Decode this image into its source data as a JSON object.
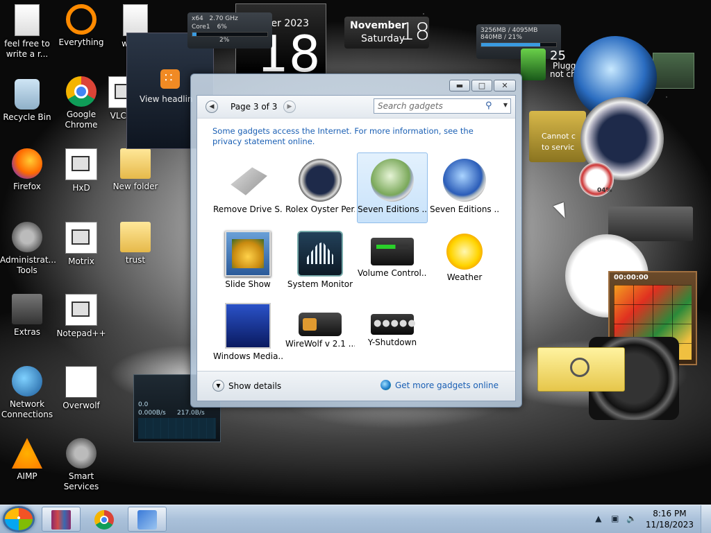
{
  "desktop_icons": [
    {
      "label": "feel free to write a r...",
      "icon": "text-document-icon"
    },
    {
      "label": "Everything",
      "icon": "everything-search-icon"
    },
    {
      "label": "www...",
      "icon": "text-document-icon"
    },
    {
      "label": "Recycle Bin",
      "icon": "recycle-bin-icon"
    },
    {
      "label": "Google Chrome",
      "icon": "chrome-icon"
    },
    {
      "label": "VLC...",
      "icon": "vlc-icon"
    },
    {
      "label": "Firefox",
      "icon": "firefox-icon"
    },
    {
      "label": "HxD",
      "icon": "hxd-icon"
    },
    {
      "label": "New folder",
      "icon": "folder-icon"
    },
    {
      "label": "Administrat... Tools",
      "icon": "admin-tools-icon"
    },
    {
      "label": "Motrix",
      "icon": "motrix-icon"
    },
    {
      "label": "trust",
      "icon": "folder-icon"
    },
    {
      "label": "Extras",
      "icon": "folder-icon"
    },
    {
      "label": "Notepad++",
      "icon": "notepad-plus-icon"
    },
    {
      "label": "Network Connections",
      "icon": "network-icon"
    },
    {
      "label": "Overwolf",
      "icon": "overwolf-icon"
    },
    {
      "label": "AIMP",
      "icon": "aimp-icon"
    },
    {
      "label": "Smart Services",
      "icon": "services-icon"
    }
  ],
  "gadgets": {
    "cpu": {
      "arch": "x64",
      "freq": "2.70 GHz",
      "core1_label": "Core1",
      "core1_value": "6%",
      "core2_value": "2%",
      "core1_fraction": 0.06,
      "core2_fraction": 0.02
    },
    "calendar": {
      "month_year": "mber 2023",
      "day": "18"
    },
    "date": {
      "month": "November",
      "weekday": "Saturday",
      "day": "18"
    },
    "memory": {
      "used": "3256MB / 4095MB",
      "free": "840MB / 21%",
      "fraction": 0.79
    },
    "rss": {
      "label": "View headlin"
    },
    "plugged": {
      "line1": "Plugg",
      "line2": "not ch",
      "num": "25"
    },
    "cannot_connect": {
      "line1": "Cannot c",
      "line2": "to servic"
    },
    "cpu_percent": "04%",
    "network": {
      "down": "0.000B/s",
      "up": "217.0B/s",
      "ip_prefix": "0.0"
    },
    "puzzle_timer": "00:00:00"
  },
  "gallery": {
    "page_label": "Page 3 of 3",
    "search_placeholder": "Search gadgets",
    "privacy_text": "Some gadgets access the Internet.  For more information, see the privacy statement online.",
    "tiles": [
      {
        "label": "Remove Drive S...",
        "icon": "usb-drive-icon"
      },
      {
        "label": "Rolex Oyster Per...",
        "icon": "rolex-clock-icon"
      },
      {
        "label": "Seven Editions ...",
        "icon": "seven-green-clock-icon",
        "selected": true
      },
      {
        "label": "Seven Editions ...",
        "icon": "seven-blue-clock-icon"
      },
      {
        "label": "Slide Show",
        "icon": "slide-show-icon"
      },
      {
        "label": "System Monitor",
        "icon": "system-monitor-icon"
      },
      {
        "label": "Volume Control...",
        "icon": "volume-control-icon"
      },
      {
        "label": "Weather",
        "icon": "weather-sun-icon"
      },
      {
        "label": "Windows Media...",
        "icon": "windows-media-center-icon"
      },
      {
        "label": "WireWolf v 2.1 ...",
        "icon": "wirewolf-icon"
      },
      {
        "label": "Y-Shutdown",
        "icon": "shutdown-icon"
      }
    ],
    "show_details": "Show details",
    "get_more": "Get more gadgets online"
  },
  "taskbar": {
    "time": "8:16 PM",
    "date": "11/18/2023",
    "apps": [
      "winrar-icon",
      "chrome-icon",
      "explorer-icon"
    ]
  }
}
